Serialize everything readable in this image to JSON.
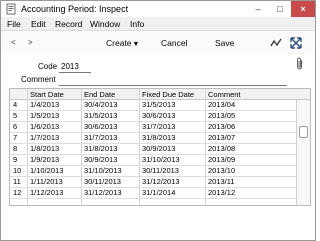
{
  "window": {
    "title": "Accounting Period: Inspect",
    "minimize": "–",
    "maximize": "□",
    "close": "×"
  },
  "menubar": {
    "items": [
      "File",
      "Edit",
      "Record",
      "Window",
      "Info"
    ]
  },
  "toolbar": {
    "prev": "<",
    "next": ">",
    "create": "Create",
    "cancel": "Cancel",
    "save": "Save"
  },
  "form": {
    "code_label": "Code",
    "code_value": "2013",
    "comment_label": "Comment",
    "comment_value": ""
  },
  "table": {
    "columns": [
      "Start Date",
      "End Date",
      "Fixed Due Date",
      "Comment"
    ],
    "rows": [
      {
        "num": "4",
        "start": "1/4/2013",
        "end": "30/4/2013",
        "fixed": "31/5/2013",
        "comment": "2013/04"
      },
      {
        "num": "5",
        "start": "1/5/2013",
        "end": "31/5/2013",
        "fixed": "30/6/2013",
        "comment": "2013/05"
      },
      {
        "num": "6",
        "start": "1/6/2013",
        "end": "30/6/2013",
        "fixed": "31/7/2013",
        "comment": "2013/06"
      },
      {
        "num": "7",
        "start": "1/7/2013",
        "end": "31/7/2013",
        "fixed": "31/8/2013",
        "comment": "2013/07"
      },
      {
        "num": "8",
        "start": "1/8/2013",
        "end": "31/8/2013",
        "fixed": "30/9/2013",
        "comment": "2013/08"
      },
      {
        "num": "9",
        "start": "1/9/2013",
        "end": "30/9/2013",
        "fixed": "31/10/2013",
        "comment": "2013/09"
      },
      {
        "num": "10",
        "start": "1/10/2013",
        "end": "31/10/2013",
        "fixed": "30/11/2013",
        "comment": "2013/10"
      },
      {
        "num": "11",
        "start": "1/11/2013",
        "end": "30/11/2013",
        "fixed": "31/12/2013",
        "comment": "2013/11"
      },
      {
        "num": "12",
        "start": "1/12/2013",
        "end": "31/12/2013",
        "fixed": "31/1/2014",
        "comment": "2013/12"
      }
    ]
  },
  "icons": {
    "app": "document-icon",
    "chart": "chart-line-icon",
    "expand": "expand-arrows-icon",
    "attach": "paperclip-icon",
    "dropdown": "triangle-down-icon"
  }
}
